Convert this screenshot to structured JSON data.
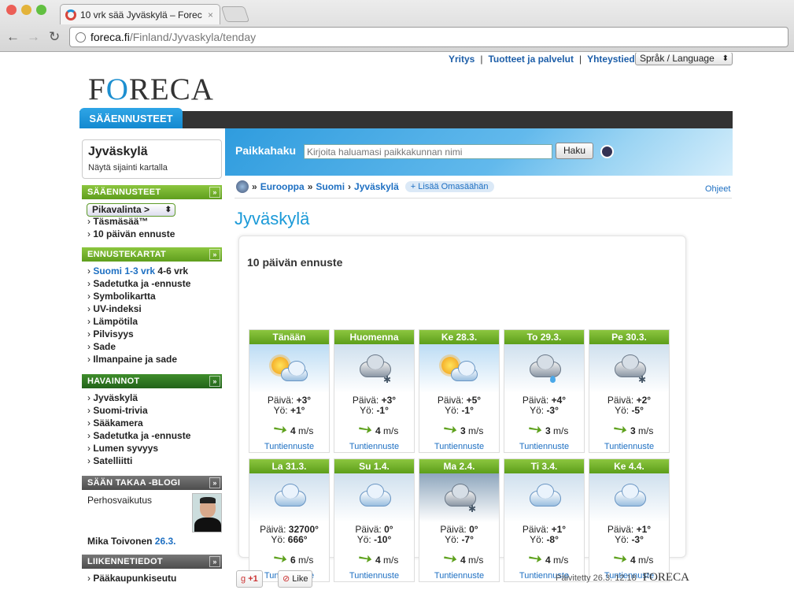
{
  "browser": {
    "tab_title": "10 vrk sää Jyväskylä – Forec",
    "tab_close": "×",
    "url_host": "foreca.fi",
    "url_path": "/Finland/Jyvaskyla/tenday"
  },
  "header": {
    "links": [
      "Yritys",
      "Tuotteet ja palvelut",
      "Yhteystiedot"
    ],
    "language": "Språk / Language",
    "logo": "FORECA",
    "nav_tab": "SÄÄENNUSTEET"
  },
  "search": {
    "label": "Paikkahaku",
    "placeholder": "Kirjoita haluamasi paikkakunnan nimi",
    "button": "Haku"
  },
  "sidebar": {
    "city": "Jyväskylä",
    "show_map": "Näytä sijainti kartalla",
    "sections": [
      {
        "title": "SÄÄENNUSTEET",
        "select": "Pikavalinta >",
        "items": [
          "Täsmäsää™",
          "10 päivän ennuste"
        ]
      },
      {
        "title": "ENNUSTEKARTAT",
        "first_item": "Suomi",
        "first_item_parts": [
          "1-3 vrk",
          "4-6 vrk"
        ],
        "items": [
          "Sadetutka ja -ennuste",
          "Symbolikartta",
          "UV-indeksi",
          "Lämpötila",
          "Pilvisyys",
          "Sade",
          "Ilmanpaine ja sade"
        ]
      },
      {
        "title": "HAVAINNOT",
        "items": [
          "Jyväskylä",
          "Suomi-trivia",
          "Sääkamera",
          "Sadetutka ja -ennuste",
          "Lumen syvyys",
          "Satelliitti"
        ]
      },
      {
        "title": "SÄÄN TAKAA -BLOGI",
        "post": "Perhosvaikutus",
        "author": "Mika Toivonen",
        "date": "26.3."
      },
      {
        "title": "LIIKENNETIEDOT",
        "items": [
          "Pääkaupunkiseutu"
        ]
      }
    ]
  },
  "breadcrumb": {
    "items": [
      "Eurooppa",
      "Suomi",
      "Jyväskylä"
    ],
    "add": "+ Lisää Omasäähän",
    "help": "Ohjeet"
  },
  "main": {
    "title": "Jyväskylä",
    "forecast_title": "10 päivän ennuste",
    "day_label": "Päivä:",
    "night_label": "Yö:",
    "wind_unit": "m/s",
    "hourly_link": "Tuntiennuste",
    "days": [
      {
        "name": "Tänään",
        "icon": "sun-cloud-icon",
        "day": "+3°",
        "night": "+1°",
        "wind": "4"
      },
      {
        "name": "Huomenna",
        "icon": "cloud-snow-icon",
        "day": "+3°",
        "night": "-1°",
        "wind": "4"
      },
      {
        "name": "Ke 28.3.",
        "icon": "sun-cloud-icon",
        "day": "+5°",
        "night": "-1°",
        "wind": "3"
      },
      {
        "name": "To 29.3.",
        "icon": "cloud-rain-icon",
        "day": "+4°",
        "night": "-3°",
        "wind": "3"
      },
      {
        "name": "Pe 30.3.",
        "icon": "cloud-snow-icon",
        "day": "+2°",
        "night": "-5°",
        "wind": "3"
      },
      {
        "name": "La 31.3.",
        "icon": "cloud-icon",
        "day": "32700°",
        "night": "666°",
        "wind": "6"
      },
      {
        "name": "Su 1.4.",
        "icon": "cloud-icon",
        "day": "0°",
        "night": "-10°",
        "wind": "4"
      },
      {
        "name": "Ma 2.4.",
        "icon": "cloud-snow-icon",
        "day": "0°",
        "night": "-7°",
        "wind": "4"
      },
      {
        "name": "Ti 3.4.",
        "icon": "cloud-icon",
        "day": "+1°",
        "night": "-8°",
        "wind": "4"
      },
      {
        "name": "Ke 4.4.",
        "icon": "cloud-icon",
        "day": "+1°",
        "night": "-3°",
        "wind": "4"
      }
    ]
  },
  "footer": {
    "gplus": "+1",
    "like": "Like",
    "updated": "Päivitetty 26.3. 12.18",
    "logo": "FORECA"
  }
}
